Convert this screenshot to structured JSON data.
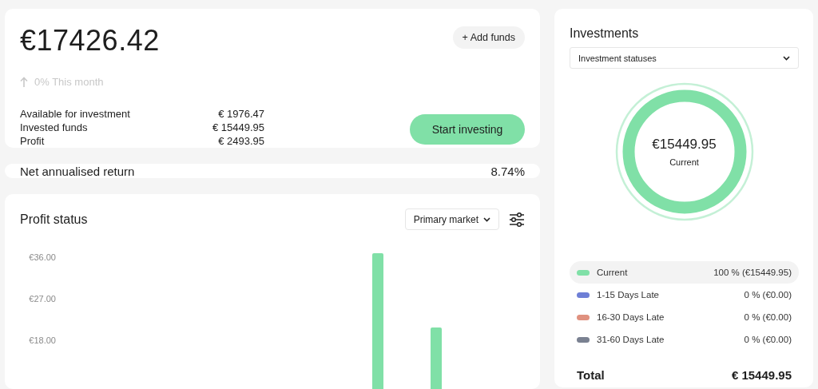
{
  "summary": {
    "balance": "€17426.42",
    "add_funds": "+ Add funds",
    "trend": "0% This month",
    "stats": [
      {
        "label": "Available for investment",
        "value": "€ 1976.47"
      },
      {
        "label": "Invested funds",
        "value": "€ 15449.95"
      },
      {
        "label": "Profit",
        "value": "€ 2493.95"
      }
    ],
    "start_button": "Start investing"
  },
  "net_return": {
    "label": "Net annualised return",
    "value": "8.74%"
  },
  "profit_status": {
    "title": "Profit status",
    "market_select": "Primary market",
    "axis_labels": [
      "€36.00",
      "€27.00",
      "€18.00"
    ]
  },
  "investments": {
    "title": "Investments",
    "select": "Investment statuses",
    "center_value": "€15449.95",
    "center_label": "Current",
    "legend": [
      {
        "label": "Current",
        "value": "100 % (€15449.95)",
        "color": "#80e0a7",
        "selected": true
      },
      {
        "label": "1-15 Days Late",
        "value": "0 % (€0.00)",
        "color": "#6e7fd6",
        "selected": false
      },
      {
        "label": "16-30 Days Late",
        "value": "0 % (€0.00)",
        "color": "#e0917f",
        "selected": false
      },
      {
        "label": "31-60 Days Late",
        "value": "0 % (€0.00)",
        "color": "#7a8191",
        "selected": false
      }
    ],
    "total_label": "Total",
    "total_value": "€ 15449.95"
  }
}
